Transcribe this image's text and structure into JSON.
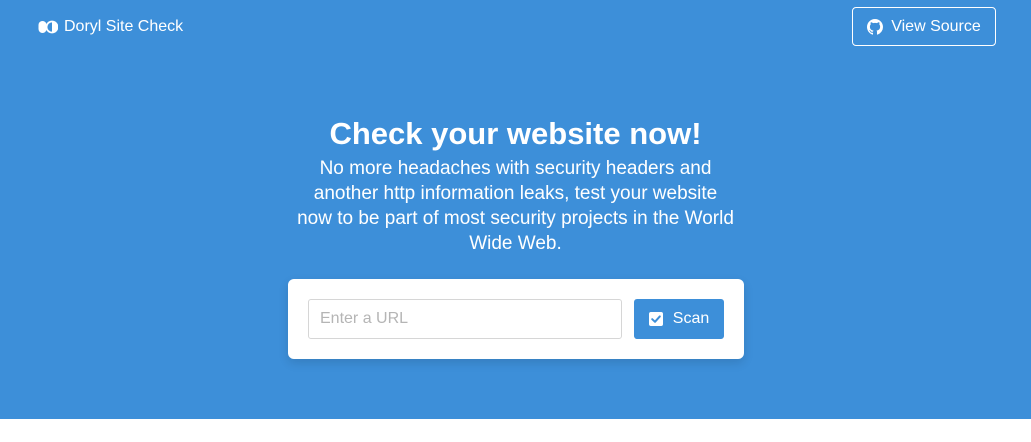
{
  "navbar": {
    "brand_icon": "pills-icon",
    "brand_label": "Doryl Site Check",
    "source_icon": "github-icon",
    "source_label": "View Source"
  },
  "hero": {
    "headline": "Check your website now!",
    "subtitle": "No more headaches with security headers and another http information leaks, test your website now to be part of most security projects in the World Wide Web."
  },
  "scan_form": {
    "url_placeholder": "Enter a URL",
    "url_value": "",
    "button_icon": "check-square-icon",
    "button_label": "Scan"
  },
  "colors": {
    "hero_background": "#3d8fd9",
    "accent": "#3d8fd9",
    "text_on_hero": "#ffffff"
  }
}
